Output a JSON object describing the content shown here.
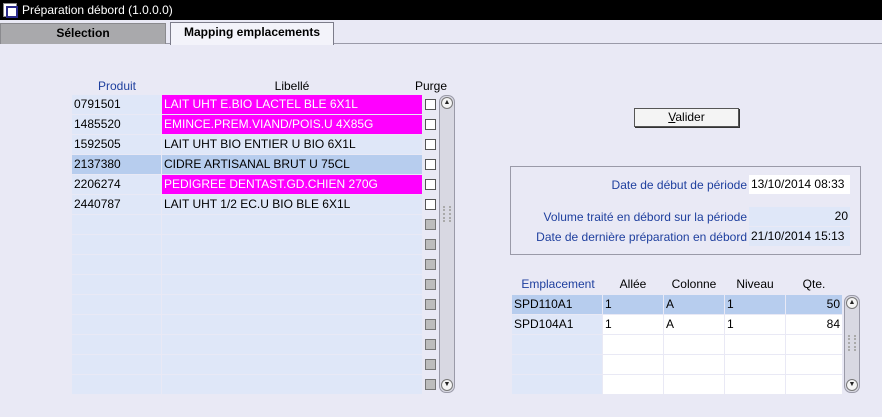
{
  "window": {
    "title": "Préparation débord (1.0.0.0)"
  },
  "tabs": [
    {
      "label": "Sélection"
    },
    {
      "label": "Mapping emplacements"
    }
  ],
  "products": {
    "headers": {
      "code": "Produit",
      "label": "Libellé",
      "purge": "Purge"
    },
    "rows": [
      {
        "code": "0791501",
        "label": "LAIT UHT E.BIO LACTEL BLE 6X1L",
        "highlight": "pink"
      },
      {
        "code": "1485520",
        "label": "EMINCE.PREM.VIAND/POIS.U 4X85G",
        "highlight": "pink"
      },
      {
        "code": "1592505",
        "label": "LAIT UHT BIO ENTIER U BIO 6X1L",
        "highlight": ""
      },
      {
        "code": "2137380",
        "label": "CIDRE ARTISANAL BRUT U 75CL",
        "highlight": "selected"
      },
      {
        "code": "2206274",
        "label": "PEDIGREE DENTAST.GD.CHIEN 270G",
        "highlight": "pink"
      },
      {
        "code": "2440787",
        "label": "LAIT UHT 1/2 EC.U BIO BLE 6X1L",
        "highlight": ""
      }
    ],
    "empty_rows": 9
  },
  "validate_button": {
    "accel": "V",
    "rest": "alider"
  },
  "period_info": {
    "start_label": "Date de début de période",
    "start_value": "13/10/2014 08:33",
    "volume_label": "Volume traité en débord sur la période",
    "volume_value": "20",
    "last_prep_label": "Date de dernière préparation en débord",
    "last_prep_value": "21/10/2014 15:13"
  },
  "locations": {
    "headers": {
      "emplacement": "Emplacement",
      "allee": "Allée",
      "colonne": "Colonne",
      "niveau": "Niveau",
      "qte": "Qte."
    },
    "rows": [
      {
        "emplacement": "SPD110A1",
        "allee": "1",
        "colonne": "A",
        "niveau": "1",
        "qte": "50"
      },
      {
        "emplacement": "SPD104A1",
        "allee": "1",
        "colonne": "A",
        "niveau": "1",
        "qte": "84"
      }
    ],
    "empty_rows": 3
  },
  "colors": {
    "highlight_pink": "#ff00ff",
    "selected_row": "#b7cdee",
    "cell_bg": "#dfe7f8",
    "header_blue": "#1e3f9e"
  }
}
